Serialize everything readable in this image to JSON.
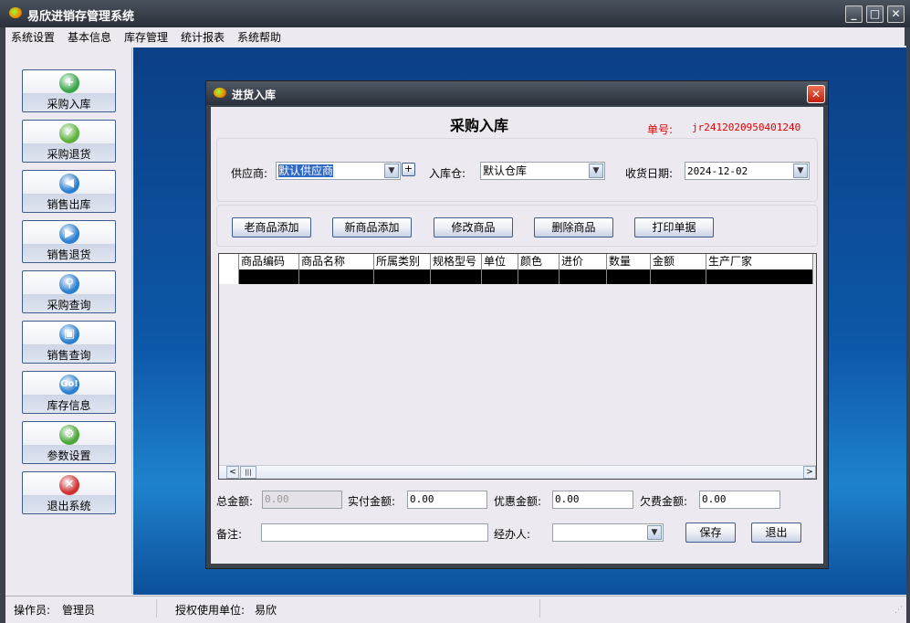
{
  "app": {
    "title": "易欣进销存管理系统",
    "icon": "app-logo-icon",
    "controls": [
      "minimize",
      "maximize",
      "close"
    ]
  },
  "menu": [
    "系统设置",
    "基本信息",
    "库存管理",
    "统计报表",
    "系统帮助"
  ],
  "sidebar": [
    {
      "label": "采购入库",
      "icon": "plus-icon",
      "color": "#3aa64a",
      "glyph": "+"
    },
    {
      "label": "采购退货",
      "icon": "check-icon",
      "color": "#5cb23c",
      "glyph": "✓"
    },
    {
      "label": "销售出库",
      "icon": "arrow-left-icon",
      "color": "#2a7fd0",
      "glyph": "◀"
    },
    {
      "label": "销售退货",
      "icon": "arrow-right-icon",
      "color": "#2a7fd0",
      "glyph": "▶"
    },
    {
      "label": "采购查询",
      "icon": "search-icon",
      "color": "#2a7fd0",
      "glyph": "⚲"
    },
    {
      "label": "销售查询",
      "icon": "ipod-icon",
      "color": "#2a7fd0",
      "glyph": "▣"
    },
    {
      "label": "库存信息",
      "icon": "go-icon",
      "color": "#2a7fd0",
      "glyph": "Go!"
    },
    {
      "label": "参数设置",
      "icon": "gear-icon",
      "color": "#4aa83a",
      "glyph": "⚙"
    },
    {
      "label": "退出系统",
      "icon": "close-icon",
      "color": "#d03030",
      "glyph": "✕"
    }
  ],
  "dialog": {
    "title": "进货入库",
    "heading": "采购入库",
    "order_no_label": "单号:",
    "order_no": "jr2412020950401240",
    "supplier_label": "供应商:",
    "supplier": "默认供应商",
    "warehouse_label": "入库仓:",
    "warehouse": "默认仓库",
    "date_label": "收货日期:",
    "date": "2024-12-02",
    "add_supplier": "+",
    "buttons": [
      "老商品添加",
      "新商品添加",
      "修改商品",
      "删除商品",
      "打印单据"
    ],
    "columns": [
      "商品编码",
      "商品名称",
      "所属类别",
      "规格型号",
      "单位",
      "颜色",
      "进价",
      "数量",
      "金额",
      "生产厂家"
    ],
    "total_label": "总金额:",
    "total": "0.00",
    "paid_label": "实付金额:",
    "paid": "0.00",
    "discount_label": "优惠金额:",
    "discount": "0.00",
    "owed_label": "欠费金额:",
    "owed": "0.00",
    "remark_label": "备注:",
    "remark": "",
    "handler_label": "经办人:",
    "handler": "",
    "save": "保存",
    "exit": "退出"
  },
  "status": {
    "operator_label": "操作员:",
    "operator": "管理员",
    "unit_label": "授权使用单位:",
    "unit": "易欣"
  }
}
